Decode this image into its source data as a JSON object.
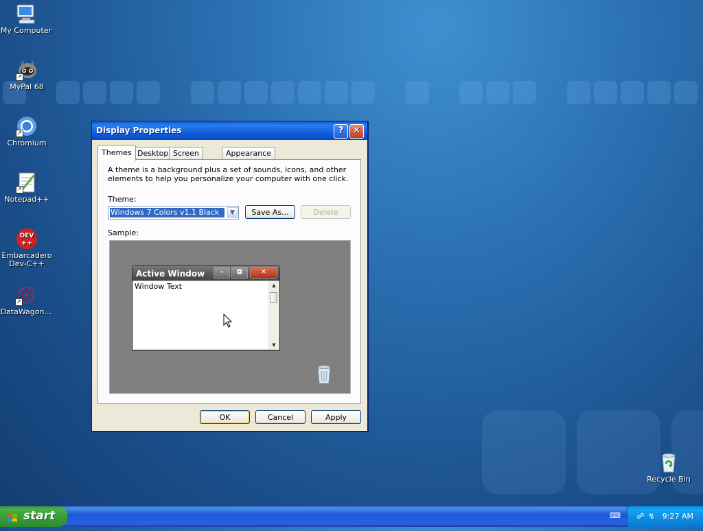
{
  "desktop": {
    "icons": [
      {
        "label": "My Computer",
        "icon": "my-computer-icon"
      },
      {
        "label": "MyPal 68",
        "icon": "mypal-raccoon-icon"
      },
      {
        "label": "Chromium",
        "icon": "chromium-icon"
      },
      {
        "label": "Notepad++",
        "icon": "notepadpp-icon"
      },
      {
        "label": "Embarcadero Dev-C++",
        "icon": "devcpp-icon",
        "badge": "DEV\n++"
      },
      {
        "label": "DataWagon…",
        "icon": "datawagon-icon"
      },
      {
        "label": "Recycle Bin",
        "icon": "recycle-bin-icon"
      }
    ]
  },
  "dialog": {
    "title": "Display Properties",
    "help_glyph": "?",
    "close_glyph": "✕",
    "tabs": [
      {
        "label": "Themes",
        "active": true
      },
      {
        "label": "Desktop",
        "active": false
      },
      {
        "label": "Screen Saver",
        "active": false
      },
      {
        "label": "Appearance",
        "active": false
      }
    ],
    "description": "A theme is a background plus a set of sounds, icons, and other elements to help you personalize your computer with one click.",
    "theme_label": "Theme:",
    "theme_value": "Windows 7 Colors v1.1 Black",
    "save_as_label": "Save As...",
    "delete_label": "Delete",
    "sample_label": "Sample:",
    "sample": {
      "window_title": "Active Window",
      "window_text": "Window Text"
    },
    "ok_label": "OK",
    "cancel_label": "Cancel",
    "apply_label": "Apply"
  },
  "taskbar": {
    "start_label": "start",
    "clock": "9:27 AM"
  },
  "colors": {
    "accent": "#316ac5",
    "titlebar": "#0a5ad8",
    "start_green": "#3c9a3c",
    "taskbar_blue": "#2157d7"
  }
}
